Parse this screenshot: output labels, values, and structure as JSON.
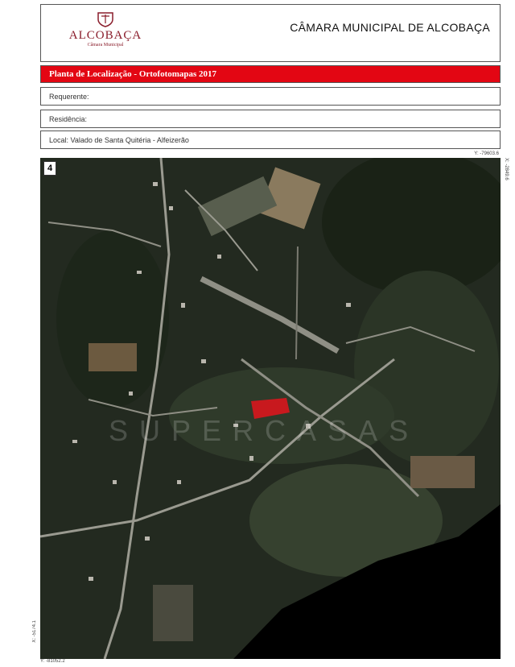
{
  "header": {
    "logo_name": "ALCOBAÇA",
    "logo_subtitle": "Câmara Municipal",
    "organization": "CÂMARA MUNICIPAL DE ALCOBAÇA"
  },
  "plan_title": "Planta de Localização - Ortofotomapas 2017",
  "fields": {
    "requerente": "Requerente:",
    "residencia": "Residência:",
    "local": "Local: Valado de Santa Quitéria - Alfeizerão"
  },
  "map": {
    "north_label": "4",
    "watermark": "SUPERCASAS",
    "coord_top": "Y: -79603.6",
    "coord_right": "X: -2849.6",
    "coord_left": "X: -5174.1",
    "coord_bottom": "Y: -81052.2"
  },
  "colors": {
    "accent": "#e30613",
    "brand": "#8a1d2b"
  }
}
